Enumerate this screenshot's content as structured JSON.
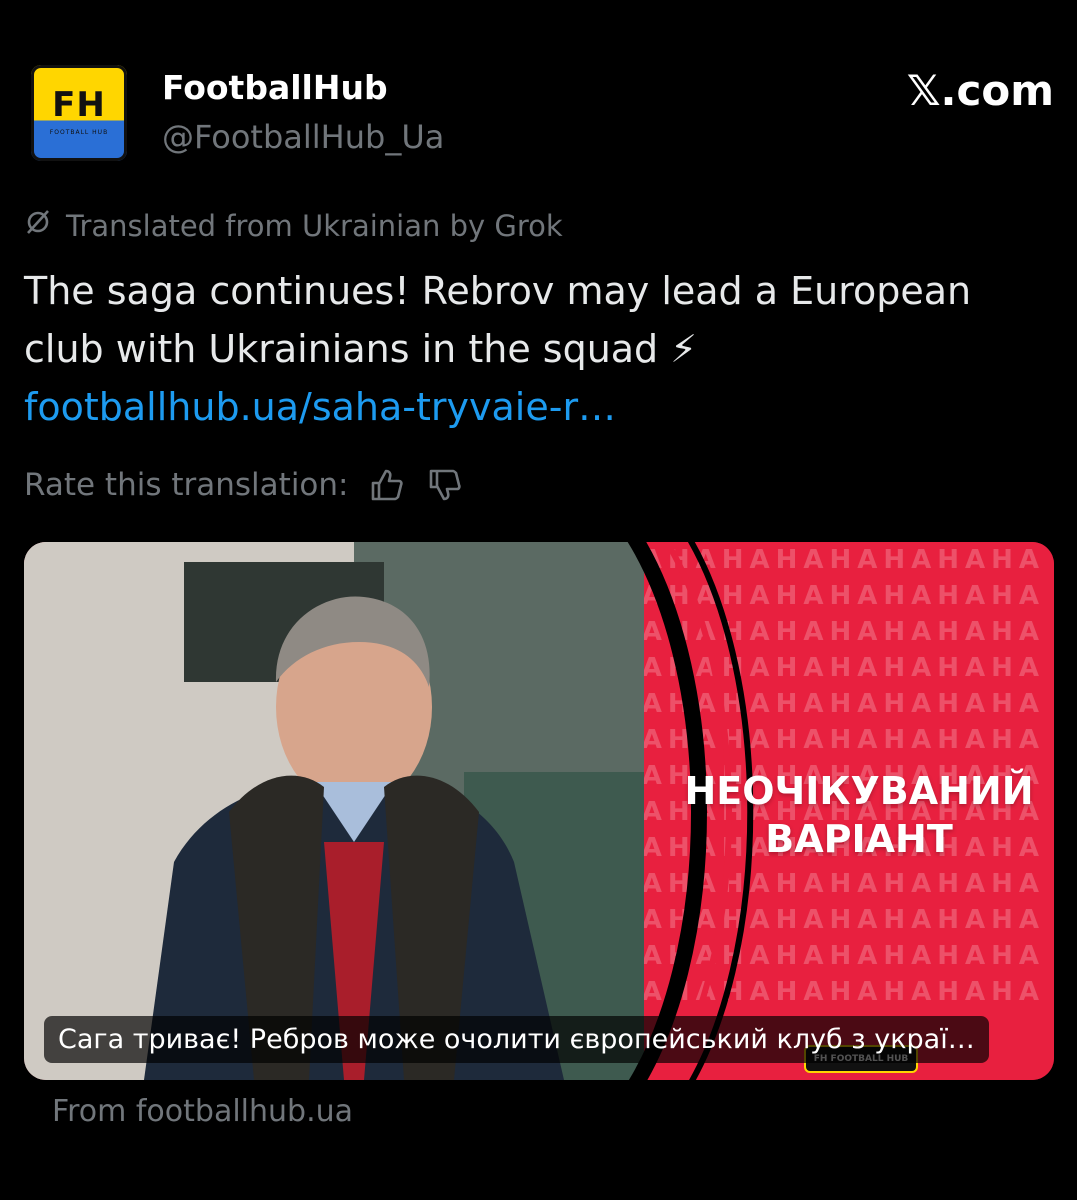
{
  "author": {
    "name": "FootballHub",
    "handle": "@FootballHub_Ua",
    "avatar_text": "FH",
    "avatar_sub": "FOOTBALL HUB"
  },
  "site_label": "𝕏.com",
  "translation": {
    "notice": "Translated from Ukrainian by Grok",
    "icon": "translate-icon"
  },
  "tweet": {
    "text": "The saga continues! Rebrov may lead a European club with Ukrainians in the squad ⚡",
    "link": "footballhub.ua/saha-tryvaie-r…"
  },
  "rate": {
    "label": "Rate this translation:",
    "thumbs_up_icon": "thumbs-up-icon",
    "thumbs_down_icon": "thumbs-down-icon"
  },
  "card": {
    "headline_line1": "НЕОЧІКУВАНИЙ",
    "headline_line2": "ВАРІАНТ",
    "caption": "Сага триває! Ребров може очолити європейський клуб з украї…",
    "logo_text": "FH FOOTBALL HUB",
    "pattern_text": "НАНАНАНАНАНАНАНАНАНАНАНАНАНАНАНАНАНАНАНАНАНАНАНАНАНАНАНАНАНАНАНАНАНАНАНАНАНАНАНАНАНАНАНАНАНАНАНАНАНАНАНАНАНАНАНАНАНАНАНАНАНАНАНАНАНАНАНАНАНАНАНАНАНАНАНАНАНАНАНАНАНАНАНАНАНАНАНАНАНАНАНАНАНАНАНАНАНАНАНАНАНАНАНА"
  },
  "source": "From footballhub.ua",
  "colors": {
    "background": "#000000",
    "link": "#1d9bf0",
    "muted": "#71767b",
    "card_red": "#e8203f"
  }
}
